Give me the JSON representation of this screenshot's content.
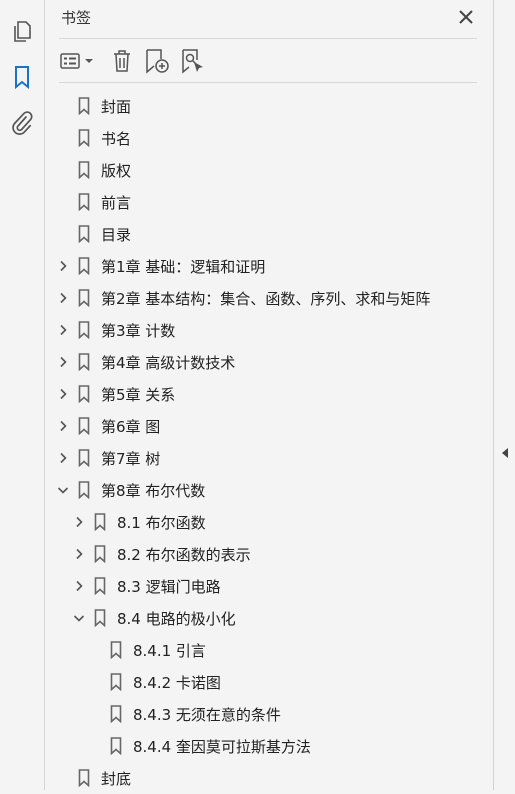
{
  "panel": {
    "title": "书签"
  },
  "bookmarks": [
    {
      "label": "封面",
      "level": 0,
      "toggle": "none"
    },
    {
      "label": "书名",
      "level": 0,
      "toggle": "none"
    },
    {
      "label": "版权",
      "level": 0,
      "toggle": "none"
    },
    {
      "label": "前言",
      "level": 0,
      "toggle": "none"
    },
    {
      "label": "目录",
      "level": 0,
      "toggle": "none"
    },
    {
      "label": "第1章 基础：逻辑和证明",
      "level": 0,
      "toggle": "collapsed"
    },
    {
      "label": "第2章 基本结构：集合、函数、序列、求和与矩阵",
      "level": 0,
      "toggle": "collapsed"
    },
    {
      "label": "第3章 计数",
      "level": 0,
      "toggle": "collapsed"
    },
    {
      "label": "第4章 高级计数技术",
      "level": 0,
      "toggle": "collapsed"
    },
    {
      "label": "第5章 关系",
      "level": 0,
      "toggle": "collapsed"
    },
    {
      "label": "第6章 图",
      "level": 0,
      "toggle": "collapsed"
    },
    {
      "label": "第7章 树",
      "level": 0,
      "toggle": "collapsed"
    },
    {
      "label": "第8章 布尔代数",
      "level": 0,
      "toggle": "expanded"
    },
    {
      "label": "8.1 布尔函数",
      "level": 1,
      "toggle": "collapsed"
    },
    {
      "label": "8.2 布尔函数的表示",
      "level": 1,
      "toggle": "collapsed"
    },
    {
      "label": "8.3 逻辑门电路",
      "level": 1,
      "toggle": "collapsed"
    },
    {
      "label": "8.4 电路的极小化",
      "level": 1,
      "toggle": "expanded"
    },
    {
      "label": "8.4.1 引言",
      "level": 2,
      "toggle": "none"
    },
    {
      "label": "8.4.2 卡诺图",
      "level": 2,
      "toggle": "none"
    },
    {
      "label": "8.4.3 无须在意的条件",
      "level": 2,
      "toggle": "none"
    },
    {
      "label": "8.4.4 奎因莫可拉斯基方法",
      "level": 2,
      "toggle": "none"
    },
    {
      "label": "封底",
      "level": 0,
      "toggle": "none"
    }
  ]
}
